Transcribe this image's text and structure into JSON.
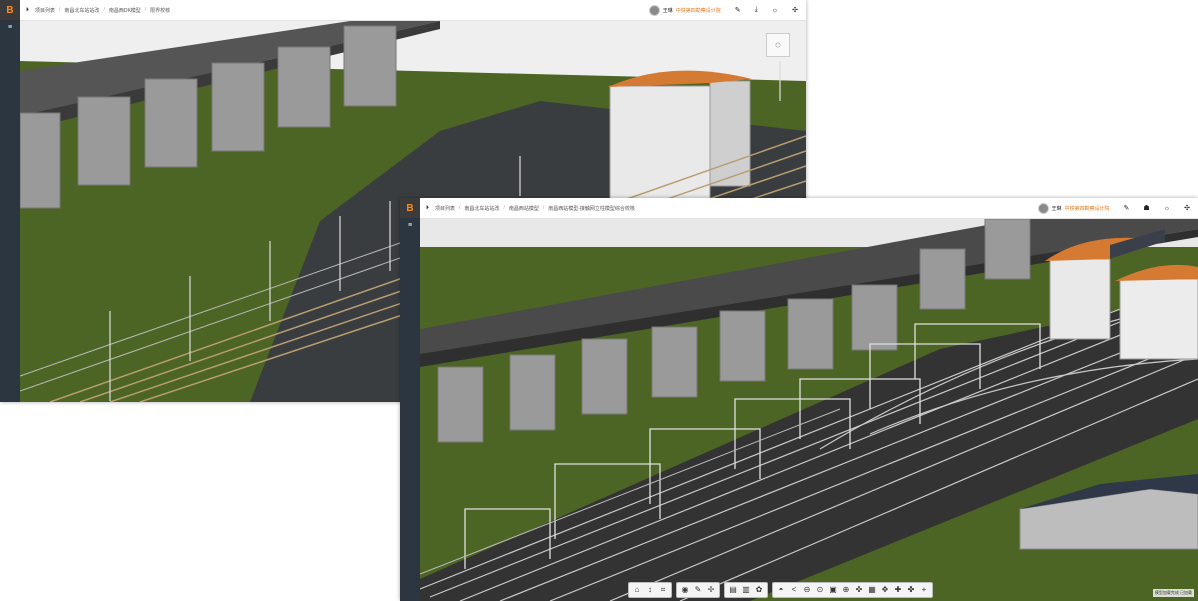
{
  "window1": {
    "logo": "B",
    "breadcrumbs": [
      "项目列表",
      "南昌北车站站改",
      "南昌西DK模型",
      "限界校核"
    ],
    "user": "王琳",
    "project": "中铁第四勘察设计院",
    "toolbar_groups": [
      [
        "⌂",
        "↕",
        "⌗"
      ],
      [
        "◉",
        "✎",
        "✢"
      ],
      [
        "▤",
        "▥",
        "✿"
      ]
    ]
  },
  "window2": {
    "logo": "B",
    "breadcrumbs": [
      "项目列表",
      "南昌北车站站改",
      "南昌西站模型",
      "南昌西站模型-接触网立柱模型综合校核"
    ],
    "user": "王琳",
    "project": "中铁第四勘察设计院",
    "toolbar_groups": [
      [
        "⌂",
        "↕",
        "⌗"
      ],
      [
        "◉",
        "✎",
        "✢"
      ],
      [
        "▤",
        "▥",
        "✿"
      ],
      [
        "◓",
        "<",
        "⊖",
        "⊙",
        "▣",
        "⊕",
        "✜",
        "▦",
        "✥",
        "✚",
        "✤",
        "+"
      ]
    ],
    "watermark": "模型加载完成 已加载"
  },
  "colors": {
    "grass": "#4c6524",
    "sky": "#efefef",
    "viaduct": "#4a4a4a",
    "pier": "#9a9a9a",
    "roof": "#d57a32",
    "sidebar": "#2b3641"
  },
  "icons": {
    "collapse": "collapse-icon",
    "menu": "menu-icon"
  }
}
